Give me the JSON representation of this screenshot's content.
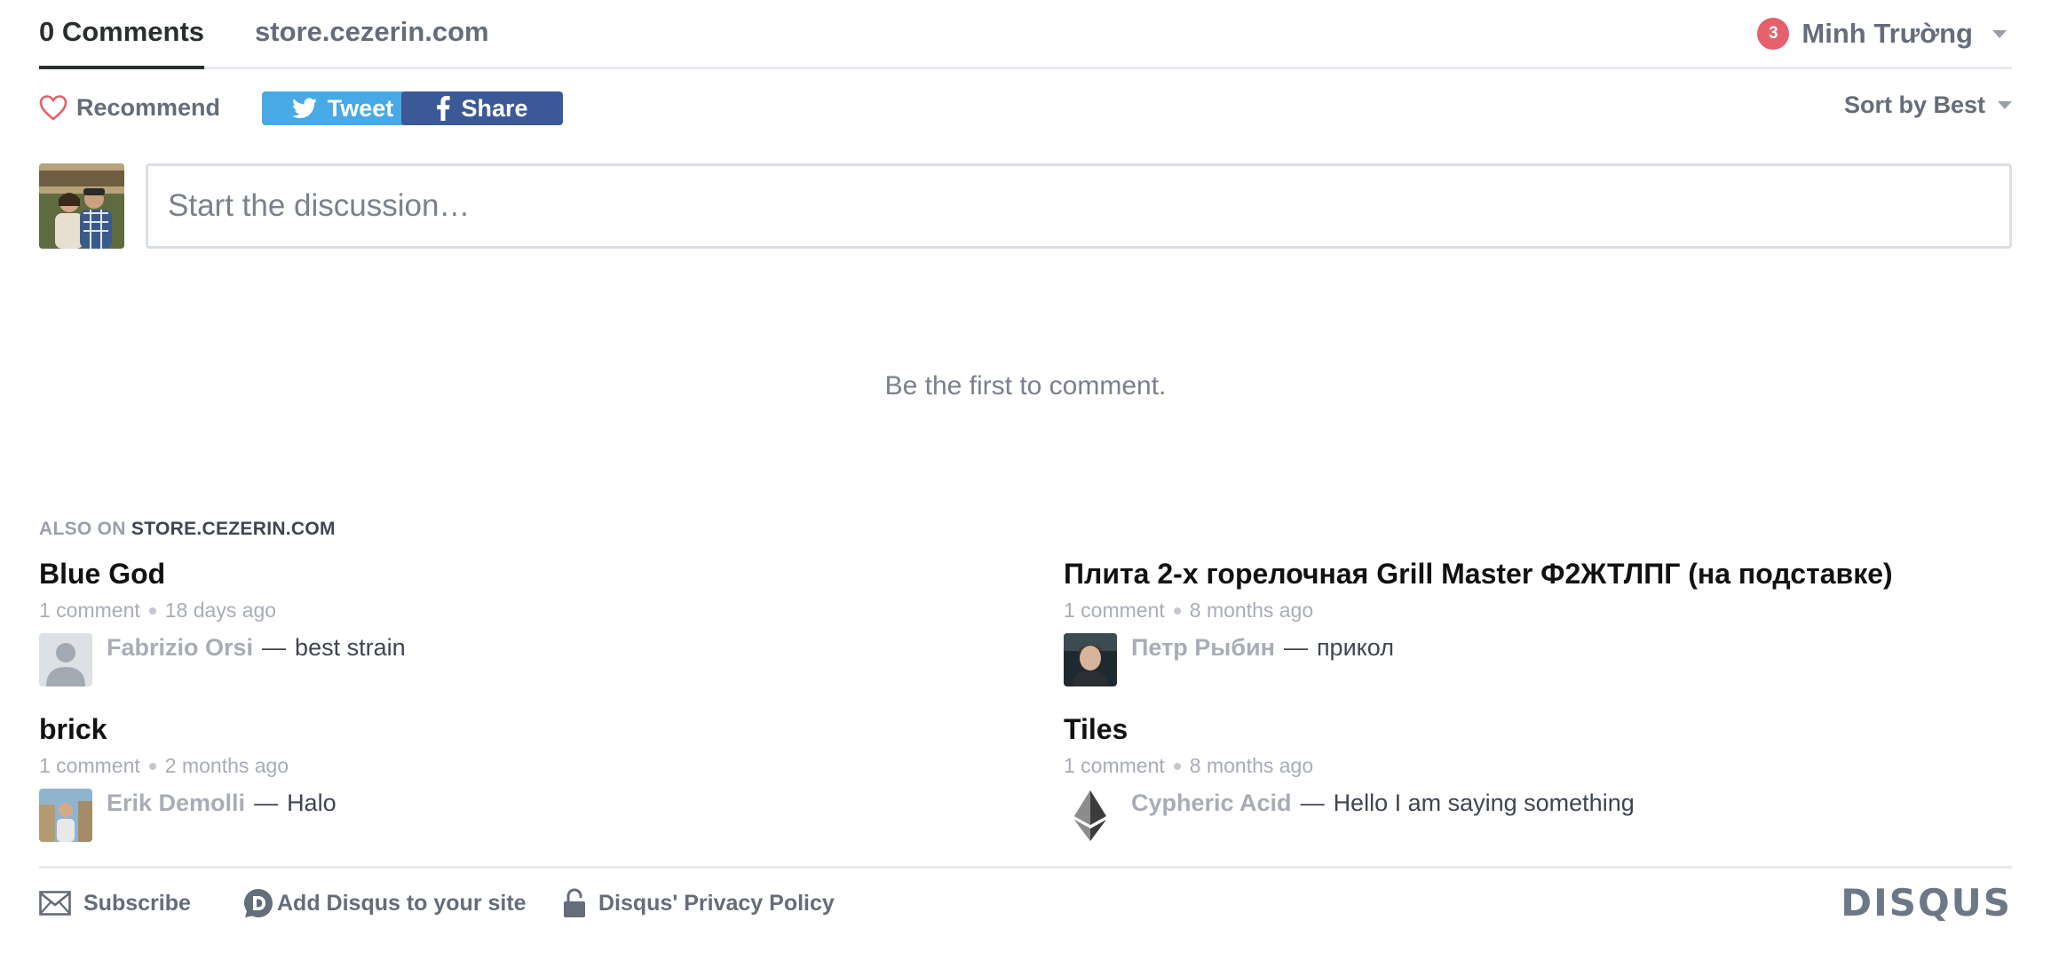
{
  "nav": {
    "tab_comments": "0 Comments",
    "tab_site": "store.cezerin.com",
    "notification_count": "3",
    "user_name": "Minh Trường"
  },
  "actions": {
    "recommend_label": "Recommend",
    "tweet_label": "Tweet",
    "share_label": "Share",
    "sort_label": "Sort by Best"
  },
  "composer": {
    "placeholder": "Start the discussion…"
  },
  "empty_message": "Be the first to comment.",
  "also_on": {
    "prefix": "ALSO ON",
    "site": "STORE.CEZERIN.COM",
    "items": [
      {
        "title": "Blue God",
        "count": "1 comment",
        "age": "18 days ago",
        "author": "Fabrizio Orsi",
        "excerpt": "best strain",
        "avatar": "default-user-icon"
      },
      {
        "title": "Плита 2-х горелочная Grill Master Ф2ЖТЛПГ (на подставке)",
        "count": "1 comment",
        "age": "8 months ago",
        "author": "Петр Рыбин",
        "excerpt": "прикол",
        "avatar": "photo"
      },
      {
        "title": "brick",
        "count": "1 comment",
        "age": "2 months ago",
        "author": "Erik Demolli",
        "excerpt": "Halo",
        "avatar": "photo"
      },
      {
        "title": "Tiles",
        "count": "1 comment",
        "age": "8 months ago",
        "author": "Cypheric Acid",
        "excerpt": "Hello I am saying something",
        "avatar": "ethereum-icon"
      }
    ]
  },
  "footer": {
    "subscribe_label": "Subscribe",
    "add_disqus_label": "Add Disqus to your site",
    "privacy_label": "Disqus' Privacy Policy",
    "logo_text": "DISQUS"
  },
  "colors": {
    "accent": "#2a2e2e",
    "muted": "#656c7a",
    "twitter": "#47a9e6",
    "facebook": "#3b5997",
    "badge": "#e4606d"
  }
}
